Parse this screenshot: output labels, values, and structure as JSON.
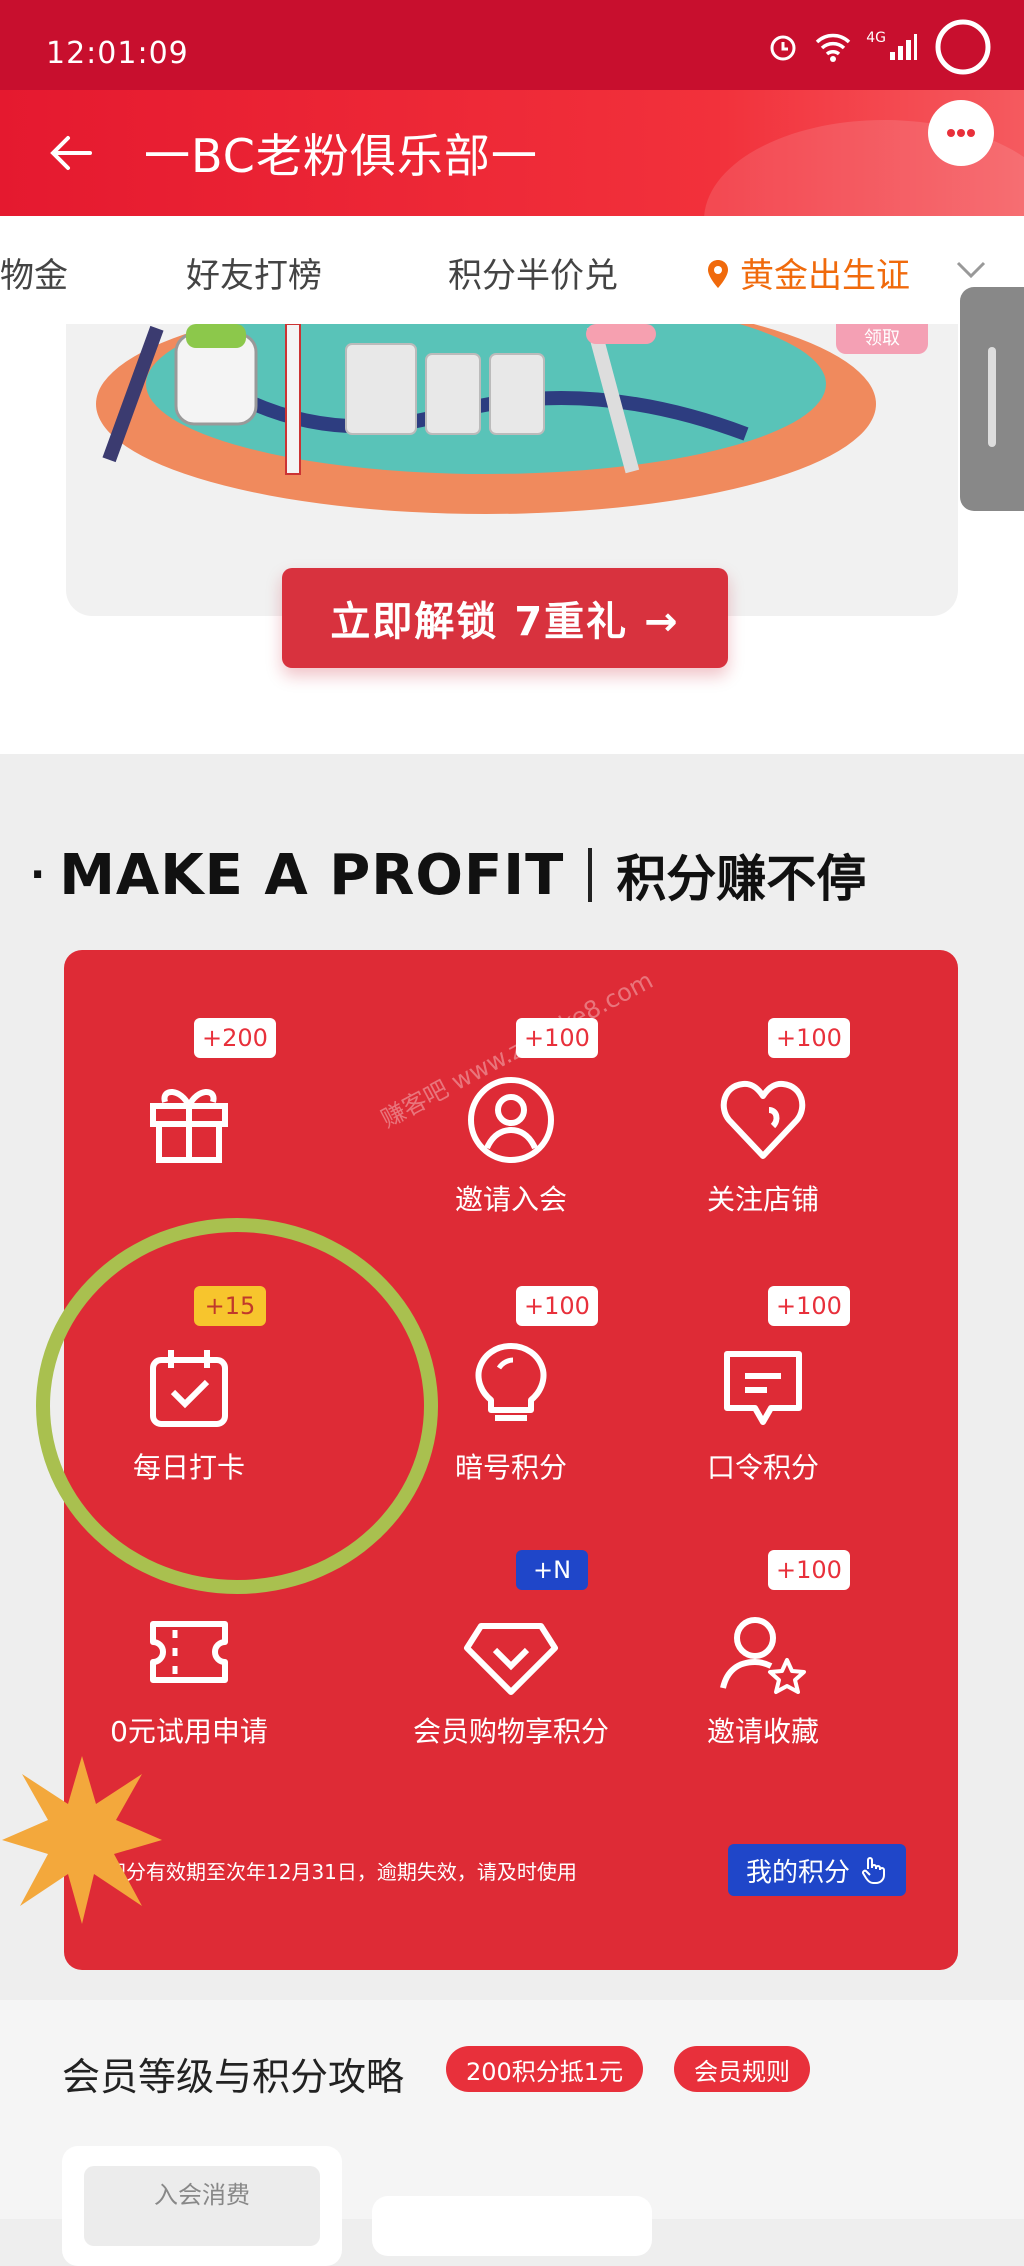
{
  "status_bar": {
    "time": "12:01:09",
    "network": "4G"
  },
  "header": {
    "title": "一BC老粉俱乐部一"
  },
  "tabs": [
    {
      "label": "物金"
    },
    {
      "label": "好友打榜"
    },
    {
      "label": "积分半价兑"
    },
    {
      "label": "黄金出生证",
      "active": true
    }
  ],
  "banner": {
    "button_label": "立即解锁 7重礼 →",
    "corner_text": "领取"
  },
  "earn_section": {
    "heading_en": "MAKE A PROFIT",
    "heading_cn": "积分赚不停",
    "items": [
      {
        "label": "",
        "badge": "+200",
        "icon": "gift-icon"
      },
      {
        "label": "邀请入会",
        "badge": "+100",
        "icon": "user-circle-icon"
      },
      {
        "label": "关注店铺",
        "badge": "+100",
        "icon": "heart-icon"
      },
      {
        "label": "每日打卡",
        "badge": "+15",
        "icon": "calendar-check-icon"
      },
      {
        "label": "暗号积分",
        "badge": "+100",
        "icon": "bulb-icon"
      },
      {
        "label": "口令积分",
        "badge": "+100",
        "icon": "chat-icon"
      },
      {
        "label": "0元试用申请",
        "badge": "",
        "icon": "ticket-icon"
      },
      {
        "label": "会员购物享积分",
        "badge": "+N",
        "icon": "diamond-check-icon"
      },
      {
        "label": "邀请收藏",
        "badge": "+100",
        "icon": "user-star-icon"
      }
    ],
    "note": "*积分有效期至次年12月31日，逾期失效，请及时使用",
    "my_points_label": "我的积分",
    "watermark": "赚客吧 www.zuanke8.com"
  },
  "bottom": {
    "title": "会员等级与积分攻略",
    "pill_1": "200积分抵1元",
    "pill_2": "会员规则",
    "card_label": "入会消费"
  },
  "colors": {
    "brand_red": "#de2b36",
    "status_red": "#c80f2e",
    "active_tab": "#f06a0c",
    "highlight_circle": "#a9c04f",
    "badge_yellow": "#f7c52d",
    "badge_blue": "#1f46c9"
  }
}
